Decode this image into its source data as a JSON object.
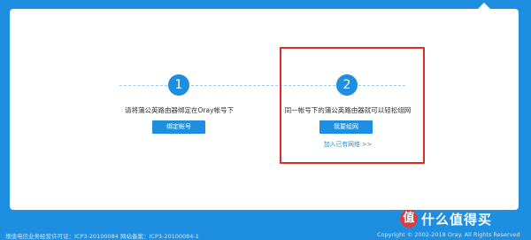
{
  "step1": {
    "number": "1",
    "text": "请将蒲公英路由器绑定在Oray帐号下",
    "button": "绑定帐号"
  },
  "step2": {
    "number": "2",
    "text": "同一帐号下的蒲公英路由器就可以轻松组网",
    "button": "我要组网",
    "link": "加入已有网络 >>"
  },
  "footer": {
    "left": "增值电信业务经营许可证：ICP3-20100084 网站备案：ICP3-20100084-1",
    "right": "Copyright © 2002-2018 Oray. All Rights Reserved"
  },
  "watermark": {
    "logo": "值",
    "text": "什么值得买"
  },
  "colors": {
    "primary": "#1e8ee0",
    "highlight": "#e02a2a",
    "card": "#ffffff"
  }
}
